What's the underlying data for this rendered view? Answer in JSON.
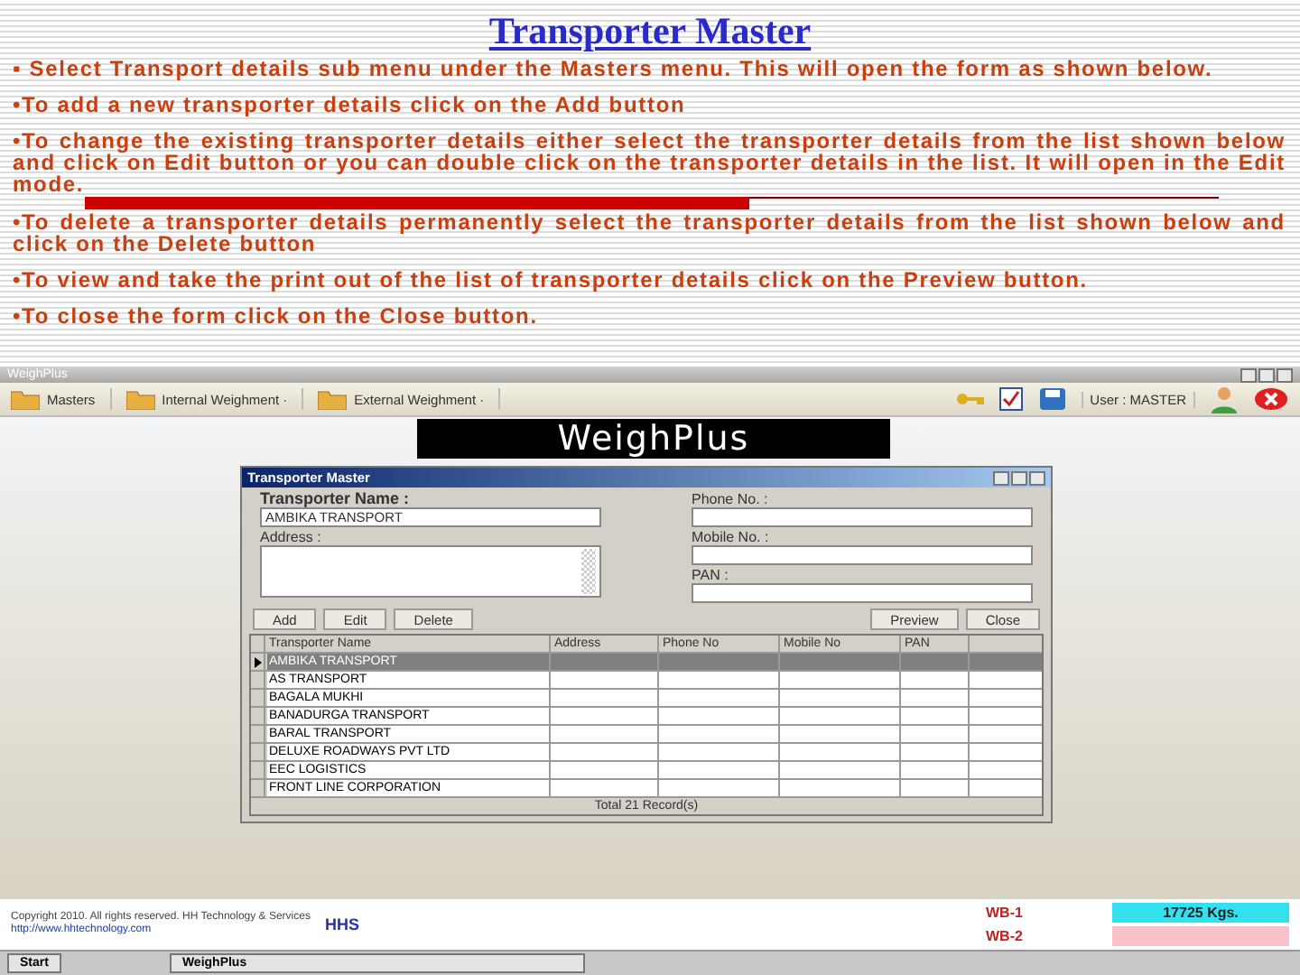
{
  "page": {
    "title": "Transporter Master",
    "bullets": [
      "▪ Select Transport details sub menu under the Masters menu. This will open the form as shown below.",
      "•To add a new transporter details click on the Add button",
      "•To change the existing transporter details either select the transporter details from the list shown below and click on Edit button or you can double click on the transporter details in the list. It will open in the Edit mode.",
      "•To delete a transporter details permanently select the transporter details from the list shown below and click on the Delete button",
      "•To view and take the print out of the list of transporter details click on the Preview button.",
      "•To close the form click on the Close button."
    ]
  },
  "app": {
    "window_title": "WeighPlus",
    "menus": [
      "Masters",
      "Internal Weighment ·",
      "External Weighment ·"
    ],
    "user": "User : MASTER",
    "logo": "WeighPlus",
    "dialog": {
      "title": "Transporter Master",
      "fields": [
        {
          "label": "Transporter Name :",
          "value": "AMBIKA TRANSPORT",
          "kind": "line"
        },
        {
          "label": "Address :",
          "kind": "area"
        }
      ],
      "right_fields": [
        {
          "label": "Phone No. :"
        },
        {
          "label": "Mobile No. :"
        },
        {
          "label": "PAN :"
        }
      ],
      "buttons_left": [
        "Add",
        "Edit",
        "Delete"
      ],
      "buttons_right": [
        "Preview",
        "Close"
      ],
      "table": {
        "columns": [
          "Transporter Name",
          "Address",
          "Phone No",
          "Mobile No",
          "PAN"
        ],
        "rows": [
          {
            "name": "AMBIKA TRANSPORT",
            "selected": true
          },
          {
            "name": "AS TRANSPORT",
            "selected": false
          },
          {
            "name": "BAGALA MUKHI",
            "selected": false
          },
          {
            "name": "BANADURGA TRANSPORT",
            "selected": false
          },
          {
            "name": "BARAL TRANSPORT",
            "selected": false
          },
          {
            "name": "DELUXE ROADWAYS PVT LTD",
            "selected": false
          },
          {
            "name": "EEC LOGISTICS",
            "selected": false
          },
          {
            "name": "FRONT LINE CORPORATION",
            "selected": false
          }
        ],
        "footer": "Total 21 Record(s)"
      }
    },
    "footer": {
      "copyright": "Copyright 2010. All rights reserved. HH Technology & Services",
      "website": "http://www.hhtechnology.com",
      "brand": "HHS"
    },
    "scales": [
      {
        "name": "WB-1",
        "reading": "17725 Kgs.",
        "color": "#33e0f0"
      },
      {
        "name": "WB-2",
        "color": "#f8c0c8"
      }
    ],
    "taskbar": {
      "start": "Start",
      "task": "WeighPlus"
    }
  }
}
